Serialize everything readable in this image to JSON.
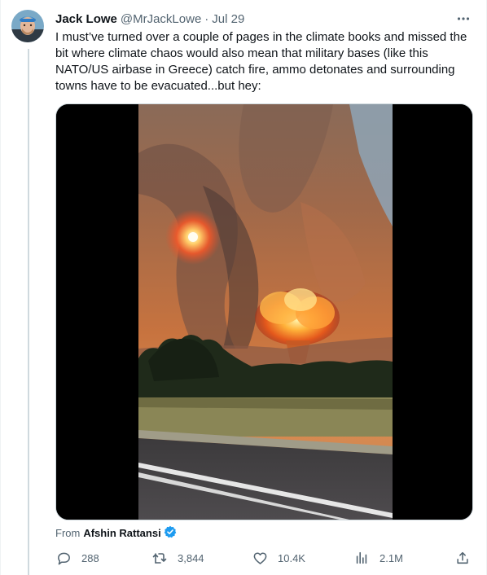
{
  "tweet": {
    "author_name": "Jack Lowe",
    "handle": "@MrJackLowe",
    "separator": "·",
    "date": "Jul 29",
    "text_lines": [
      "I must’ve turned over a couple of pages in the climate books and missed the",
      "bit where climate chaos would also mean that military bases (like this",
      "NATO/US airbase in Greece) catch fire, ammo detonates and surrounding",
      "towns have to be evacuated...but hey:"
    ],
    "media_icon": "video-explosion-scene",
    "attribution": {
      "label": "From",
      "name": "Afshin Rattansi",
      "badge_icon": "verified-badge-icon"
    },
    "actions": {
      "replies": "288",
      "retweets": "3,844",
      "likes": "10.4K",
      "views": "2.1M"
    }
  },
  "colors": {
    "text": "#0f1419",
    "secondary": "#536471",
    "verified": "#1d9bf0",
    "thread_line": "#cfd9de",
    "media_bg": "#000000"
  }
}
